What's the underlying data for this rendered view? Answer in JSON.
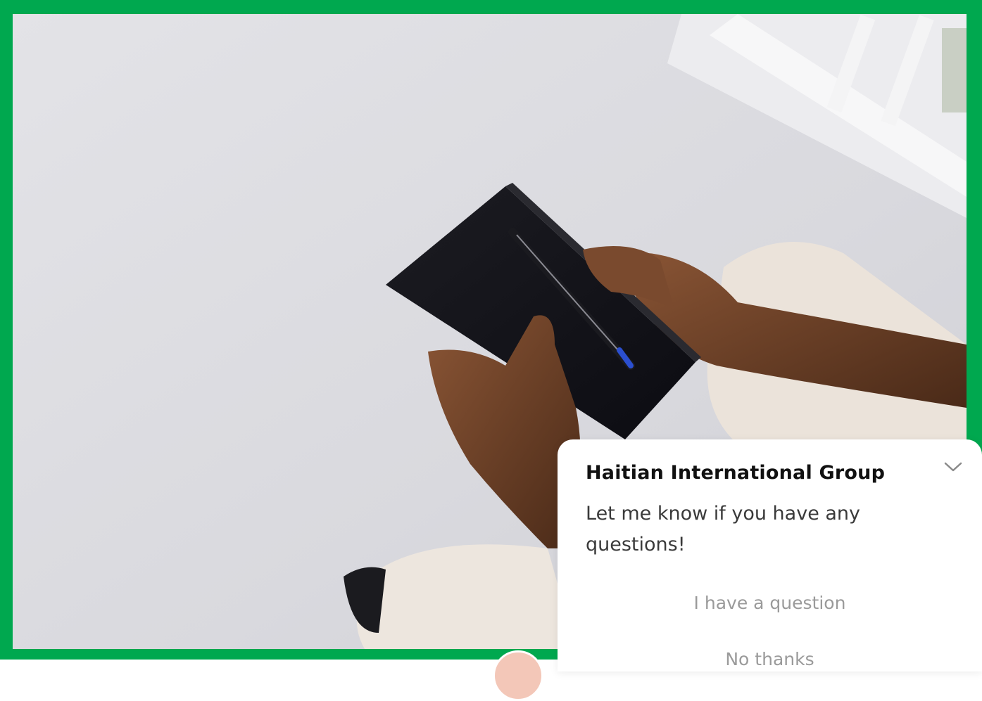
{
  "theme": {
    "frame_color": "#00a84f",
    "popup_background": "#ffffff"
  },
  "chat": {
    "company_name": "Haitian International Group",
    "message": "Let me know if you have any questions!",
    "collapse_icon": "chevron-down-icon",
    "options": [
      {
        "label": "I have a question"
      },
      {
        "label": "No thanks"
      }
    ]
  }
}
